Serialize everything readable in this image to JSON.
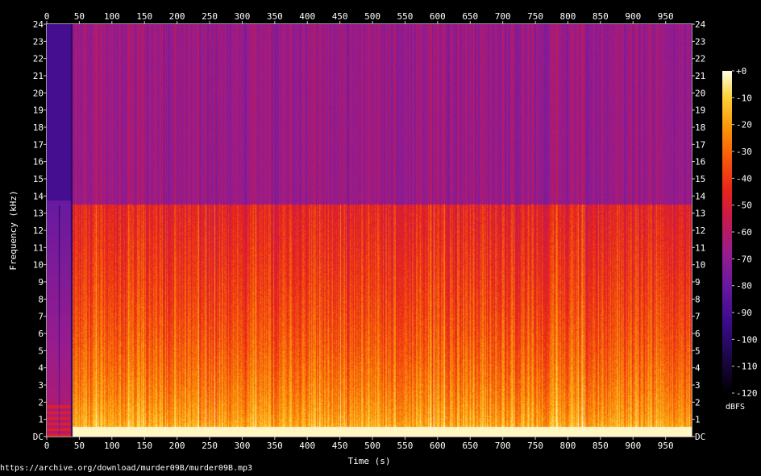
{
  "source_url": "https://archive.org/download/murder09B/murder09B.mp3",
  "chart_data": {
    "type": "heatmap",
    "xlabel": "Time (s)",
    "ylabel": "Frequency (kHz)",
    "xlim": [
      0,
      990
    ],
    "ylim": [
      0,
      24
    ],
    "x_ticks": [
      "0",
      "50",
      "100",
      "150",
      "200",
      "250",
      "300",
      "350",
      "400",
      "450",
      "500",
      "550",
      "600",
      "650",
      "700",
      "750",
      "800",
      "850",
      "900",
      "950"
    ],
    "y_ticks": [
      "DC",
      "1",
      "2",
      "3",
      "4",
      "5",
      "6",
      "7",
      "8",
      "9",
      "10",
      "11",
      "12",
      "13",
      "14",
      "15",
      "16",
      "17",
      "18",
      "19",
      "20",
      "21",
      "22",
      "23",
      "24"
    ],
    "lowpass_cutoff_khz": 13.5,
    "colorbar": {
      "label": "dBFS",
      "range": [
        -120,
        0
      ],
      "ticks": [
        "+0",
        "-10",
        "-20",
        "-30",
        "-40",
        "-50",
        "-60",
        "-70",
        "-80",
        "-90",
        "-100",
        "-110",
        "-120"
      ],
      "colors": [
        "#000000",
        "#1a0642",
        "#3c0b8c",
        "#6a1aa0",
        "#9a1c8c",
        "#c8194e",
        "#e8241a",
        "#f65a0a",
        "#fb9a0a",
        "#fdd23a",
        "#ffffe6"
      ]
    }
  }
}
